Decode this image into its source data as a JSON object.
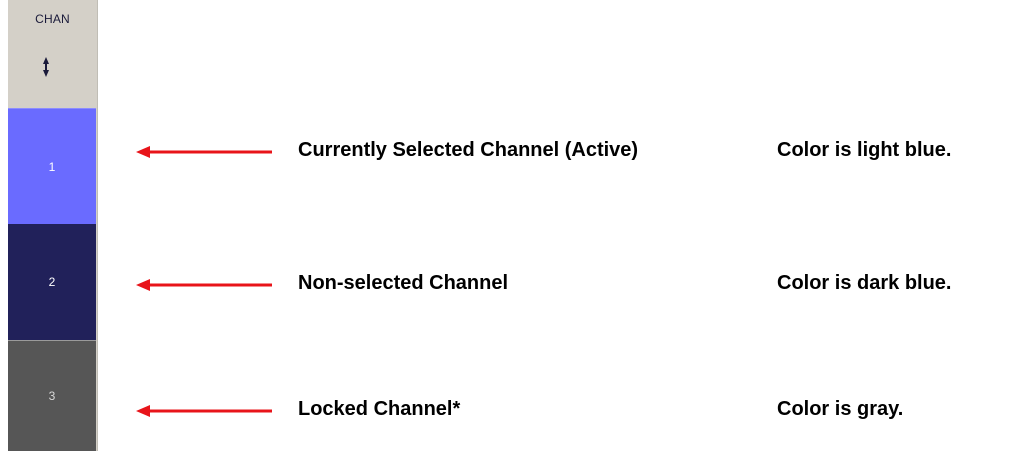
{
  "channel_panel": {
    "title": "CHAN",
    "channels": [
      {
        "label": "1",
        "state": "active",
        "color": "#6a6bff"
      },
      {
        "label": "2",
        "state": "non-selected",
        "color": "#21215a"
      },
      {
        "label": "3",
        "state": "locked",
        "color": "#565656"
      }
    ]
  },
  "annotations": [
    {
      "label": "Currently Selected Channel (Active)",
      "description": "Color is light blue."
    },
    {
      "label": "Non-selected Channel",
      "description": "Color is dark blue."
    },
    {
      "label": "Locked Channel*",
      "description": "Color is gray."
    }
  ],
  "arrow_color": "#e8141a"
}
